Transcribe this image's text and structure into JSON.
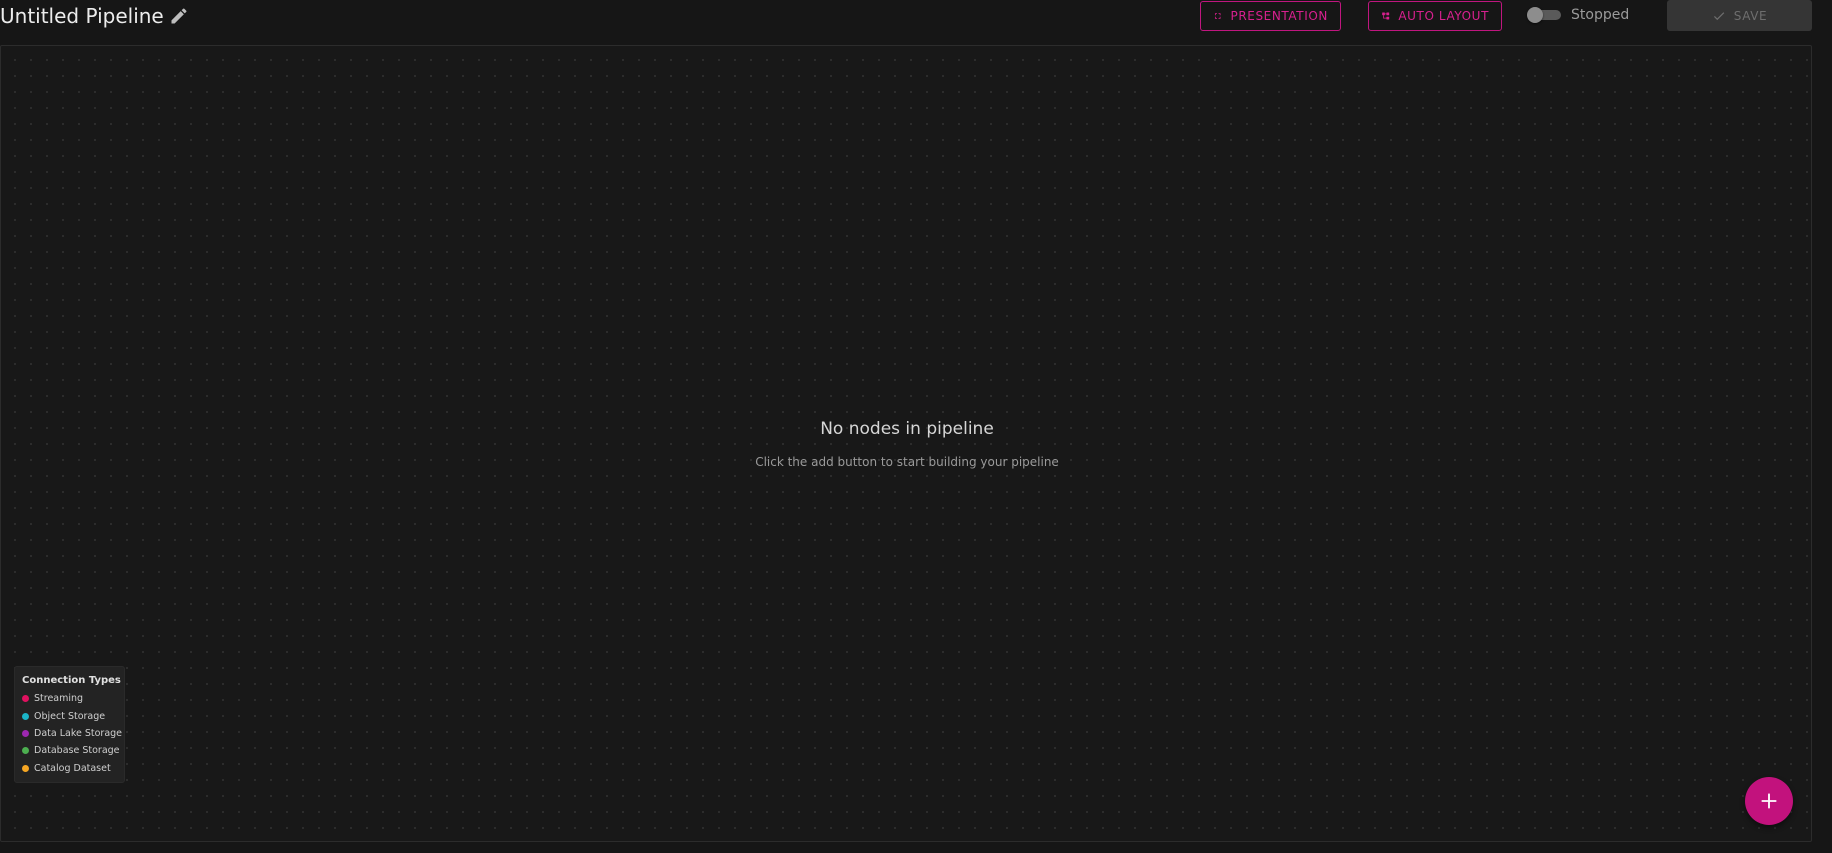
{
  "header": {
    "title": "Untitled Pipeline",
    "edit_icon": "pencil-icon",
    "presentation_label": "PRESENTATION",
    "presentation_icon": "fullscreen-icon",
    "auto_layout_label": "AUTO LAYOUT",
    "auto_layout_icon": "hierarchy-icon",
    "status_label": "Stopped",
    "running": false,
    "save_label": "SAVE",
    "save_icon": "check-icon",
    "save_enabled": false
  },
  "canvas": {
    "empty_title": "No nodes in pipeline",
    "empty_subtitle": "Click the add button to start building your pipeline"
  },
  "legend": {
    "title": "Connection Types",
    "items": [
      {
        "label": "Streaming",
        "color": "#e0115f"
      },
      {
        "label": "Object Storage",
        "color": "#1bb5c7"
      },
      {
        "label": "Data Lake Storage",
        "color": "#9c27b0"
      },
      {
        "label": "Database Storage",
        "color": "#4caf50"
      },
      {
        "label": "Catalog Dataset",
        "color": "#f5a623"
      }
    ]
  },
  "fab": {
    "icon": "plus-icon"
  },
  "colors": {
    "accent": "#c2127d",
    "background": "#161616"
  }
}
